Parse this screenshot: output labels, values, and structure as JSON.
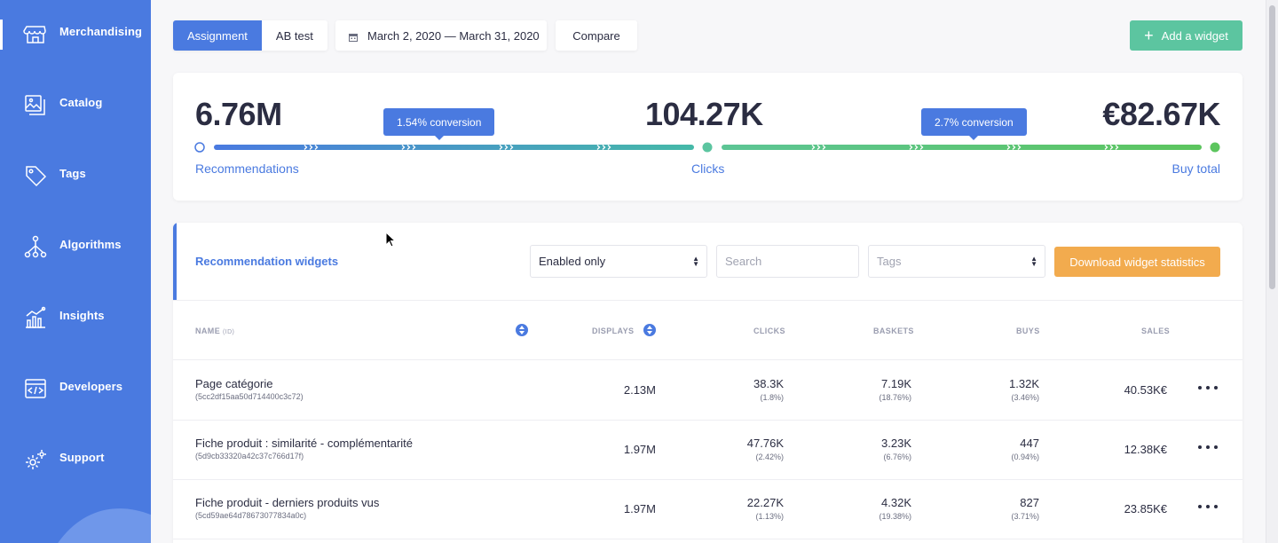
{
  "sidebar": {
    "items": [
      {
        "label": "Merchandising",
        "icon": "storefront-icon"
      },
      {
        "label": "Catalog",
        "icon": "catalog-icon"
      },
      {
        "label": "Tags",
        "icon": "tag-icon"
      },
      {
        "label": "Algorithms",
        "icon": "algorithm-icon"
      },
      {
        "label": "Insights",
        "icon": "chart-icon"
      },
      {
        "label": "Developers",
        "icon": "code-icon"
      },
      {
        "label": "Support",
        "icon": "gears-icon"
      }
    ]
  },
  "toolbar": {
    "tab_assignment": "Assignment",
    "tab_abtest": "AB test",
    "date_range": "March 2, 2020 — March 31, 2020",
    "compare": "Compare",
    "add_widget": "Add a widget"
  },
  "funnel": {
    "recommendations_value": "6.76M",
    "recommendations_label": "Recommendations",
    "clicks_value": "104.27K",
    "clicks_label": "Clicks",
    "buy_value": "€82.67K",
    "buy_label": "Buy total",
    "conversion_1": "1.54% conversion",
    "conversion_2": "2.7% conversion"
  },
  "widgets": {
    "title": "Recommendation widgets",
    "filter_value": "Enabled only",
    "search_placeholder": "Search",
    "tags_placeholder": "Tags",
    "download": "Download widget statistics",
    "columns": {
      "name": "NAME",
      "name_sub": "(ID)",
      "displays": "DISPLAYS",
      "clicks": "CLICKS",
      "baskets": "BASKETS",
      "buys": "BUYS",
      "sales": "SALES"
    },
    "rows": [
      {
        "name": "Page catégorie",
        "id": "(5cc2df15aa50d714400c3c72)",
        "displays": "2.13M",
        "clicks": "38.3K",
        "clicks_pct": "(1.8%)",
        "baskets": "7.19K",
        "baskets_pct": "(18.76%)",
        "buys": "1.32K",
        "buys_pct": "(3.46%)",
        "sales": "40.53K€"
      },
      {
        "name": "Fiche produit : similarité - complémentarité",
        "id": "(5d9cb33320a42c37c766d17f)",
        "displays": "1.97M",
        "clicks": "47.76K",
        "clicks_pct": "(2.42%)",
        "baskets": "3.23K",
        "baskets_pct": "(6.76%)",
        "buys": "447",
        "buys_pct": "(0.94%)",
        "sales": "12.38K€"
      },
      {
        "name": "Fiche produit - derniers produits vus",
        "id": "(5cd59ae64d78673077834a0c)",
        "displays": "1.97M",
        "clicks": "22.27K",
        "clicks_pct": "(1.13%)",
        "baskets": "4.32K",
        "baskets_pct": "(19.38%)",
        "buys": "827",
        "buys_pct": "(3.71%)",
        "sales": "23.85K€"
      }
    ]
  },
  "colors": {
    "primary": "#4a7ae0",
    "success": "#5cc5a0",
    "warning": "#f2ab4e"
  }
}
